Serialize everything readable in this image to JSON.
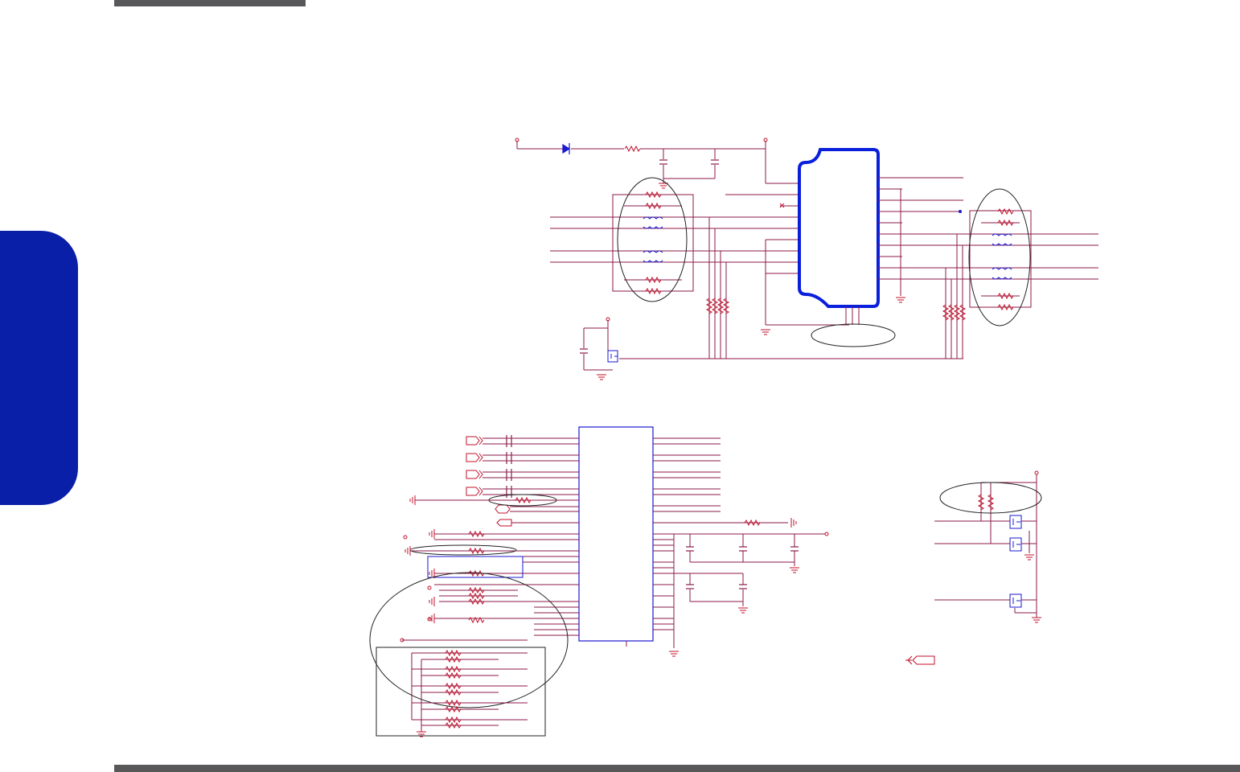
{
  "page": {
    "header_bar_color": "#58585a",
    "footer_bar_color": "#58585a",
    "side_tab_color": "#0a1fa8"
  },
  "schematic": {
    "wire_color": "#8b1a4a",
    "net_color": "#c0102a",
    "component_color": "#1a1ad0",
    "outline_color": "#222222",
    "sections": [
      "top-connector-section",
      "bottom-controller-section",
      "bottom-right-switch-section"
    ]
  }
}
